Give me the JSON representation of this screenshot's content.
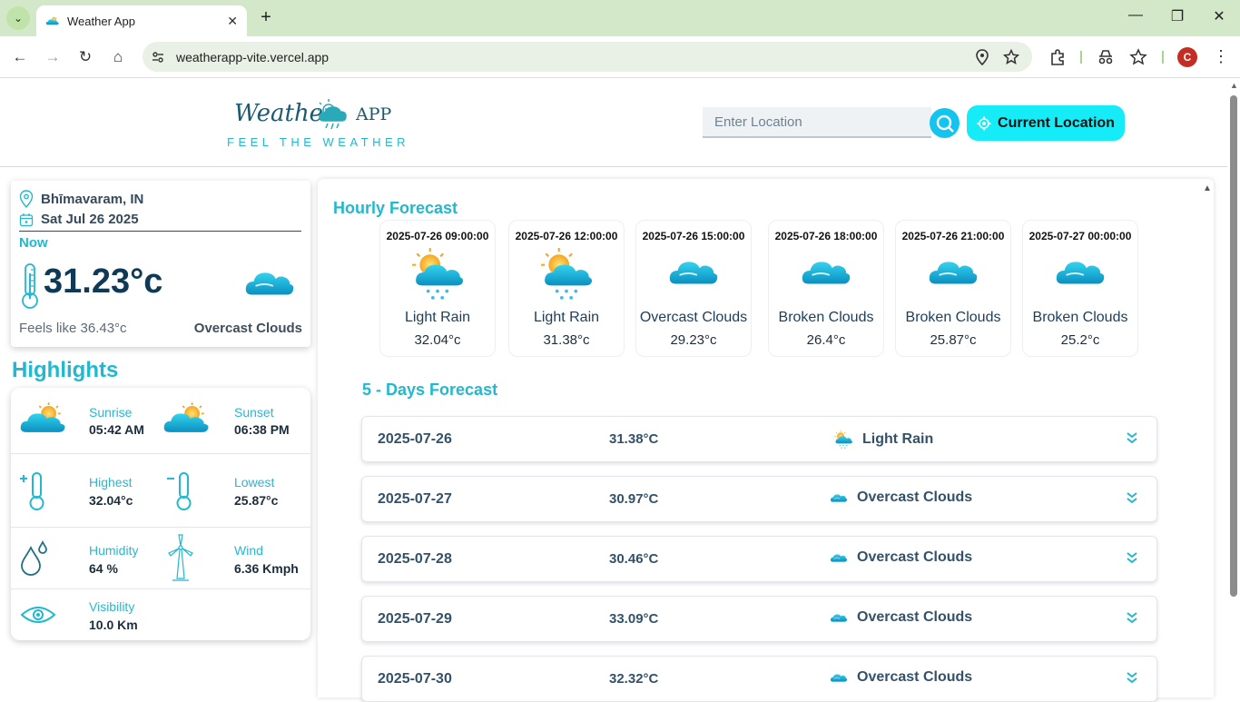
{
  "browser": {
    "tab_title": "Weather App",
    "tab_close": "✕",
    "new_tab": "+",
    "url": "weatherapp-vite.vercel.app",
    "profile_initial": "C",
    "min": "—",
    "max": "❐",
    "close": "✕",
    "back": "←",
    "forward": "→",
    "reload": "↻",
    "home": "⌂",
    "menu": "⋮",
    "tab_menu": "⌄"
  },
  "header": {
    "logo_left": "Weather",
    "logo_right": "APP",
    "tagline": "FEEL THE WEATHER",
    "search_placeholder": "Enter Location",
    "current_location_label": "Current Location"
  },
  "now": {
    "location": "Bhīmavaram, IN",
    "date": "Sat Jul 26 2025",
    "label": "Now",
    "temp": "31.23°c",
    "feels_like": "Feels like 36.43°c",
    "condition": "Overcast Clouds"
  },
  "highlights": {
    "title": "Highlights",
    "sunrise_label": "Sunrise",
    "sunrise": "05:42 AM",
    "sunset_label": "Sunset",
    "sunset": "06:38 PM",
    "highest_label": "Highest",
    "highest": "32.04°c",
    "lowest_label": "Lowest",
    "lowest": "25.87°c",
    "humidity_label": "Humidity",
    "humidity": "64 %",
    "wind_label": "Wind",
    "wind": "6.36 Kmph",
    "visibility_label": "Visibility",
    "visibility": "10.0 Km"
  },
  "hourly": {
    "title": "Hourly Forecast",
    "items": [
      {
        "time": "2025-07-26 09:00:00",
        "desc": "Light Rain",
        "temp": "32.04°c",
        "icon": "rain-icon"
      },
      {
        "time": "2025-07-26 12:00:00",
        "desc": "Light Rain",
        "temp": "31.38°c",
        "icon": "rain-icon"
      },
      {
        "time": "2025-07-26 15:00:00",
        "desc": "Overcast Clouds",
        "temp": "29.23°c",
        "icon": "cloud-icon"
      },
      {
        "time": "2025-07-26 18:00:00",
        "desc": "Broken Clouds",
        "temp": "26.4°c",
        "icon": "cloud-icon"
      },
      {
        "time": "2025-07-26 21:00:00",
        "desc": "Broken Clouds",
        "temp": "25.87°c",
        "icon": "cloud-icon"
      },
      {
        "time": "2025-07-27 00:00:00",
        "desc": "Broken Clouds",
        "temp": "25.2°c",
        "icon": "cloud-icon"
      }
    ]
  },
  "daily": {
    "title": "5 - Days Forecast",
    "items": [
      {
        "date": "2025-07-26",
        "temp": "31.38°C",
        "cond": "Light Rain",
        "icon": "rain-icon"
      },
      {
        "date": "2025-07-27",
        "temp": "30.97°C",
        "cond": "Overcast Clouds",
        "icon": "cloud-icon"
      },
      {
        "date": "2025-07-28",
        "temp": "30.46°C",
        "cond": "Overcast Clouds",
        "icon": "cloud-icon"
      },
      {
        "date": "2025-07-29",
        "temp": "33.09°C",
        "cond": "Overcast Clouds",
        "icon": "cloud-icon"
      },
      {
        "date": "2025-07-30",
        "temp": "32.32°C",
        "cond": "Overcast Clouds",
        "icon": "cloud-icon"
      }
    ]
  },
  "colors": {
    "accent": "#22b8cf",
    "button": "#15ecf7",
    "dark": "#0e3a56"
  }
}
